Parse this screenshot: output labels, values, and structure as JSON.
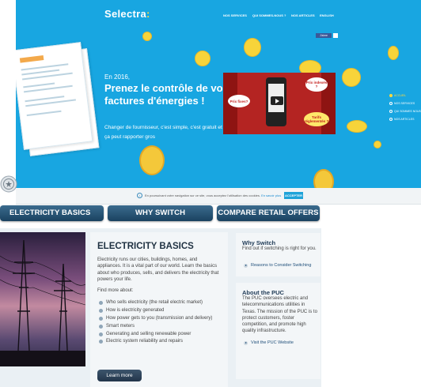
{
  "hero": {
    "logo": "Selectra",
    "nav": [
      "NOS SERVICES",
      "QUI SOMMES-NOUS ?",
      "NOS ARTICLES",
      "ENGLISH"
    ],
    "social_label": "J'aime",
    "year": "En 2016,",
    "headline": "Prenez le contrôle de vos factures d'énergies !",
    "subtext": "Changer de fournisseur, c'est simple, c'est gratuit et ça peut rapporter gros",
    "video_bubbles": [
      "Prix fixes?",
      "Prix indexés ?",
      "Tarifs réglementés ?"
    ],
    "side_nav": [
      "ACCUEIL",
      "NOS SERVICES",
      "QUI SOMMES NOUS",
      "NOS ARTICLES"
    ],
    "side_nav_active": 0,
    "colors": {
      "background": "#18a6e1",
      "accent": "#ffd93b"
    }
  },
  "cookie_bar": {
    "text": "En poursuivant votre navigation sur ce site, vous acceptez l'utilisation des cookies.",
    "link": "En savoir plus",
    "button": "ACCEPTER"
  },
  "tabs": [
    "ELECTRICITY BASICS",
    "WHY SWITCH",
    "COMPARE RETAIL OFFERS"
  ],
  "main": {
    "title": "ELECTRICITY BASICS",
    "intro": "Electricity runs our cities, buildings, homes, and appliances. It is a vital part of our world. Learn the basics about who produces, sells, and delivers the electricity that powers your life.",
    "find_more": "Find more about:",
    "items": [
      "Who sells electricity (the retail electric market)",
      "How is electricity generated",
      "How power gets to you (transmission and delivery)",
      "Smart meters",
      "Generating and selling renewable power",
      "Electric system reliability and repairs"
    ],
    "button": "Learn more"
  },
  "sidebar": {
    "why": {
      "title": "Why Switch",
      "text": "Find out if switching is right for you.",
      "link": "Reasons to Consider Switching"
    },
    "puc": {
      "title": "About the PUC",
      "text": "The PUC oversees electric and telecommunications utilities in Texas. The mission of the PUC is to protect customers, foster competition, and promote high quality infrastructure.",
      "link": "Visit the PUC Website"
    }
  }
}
